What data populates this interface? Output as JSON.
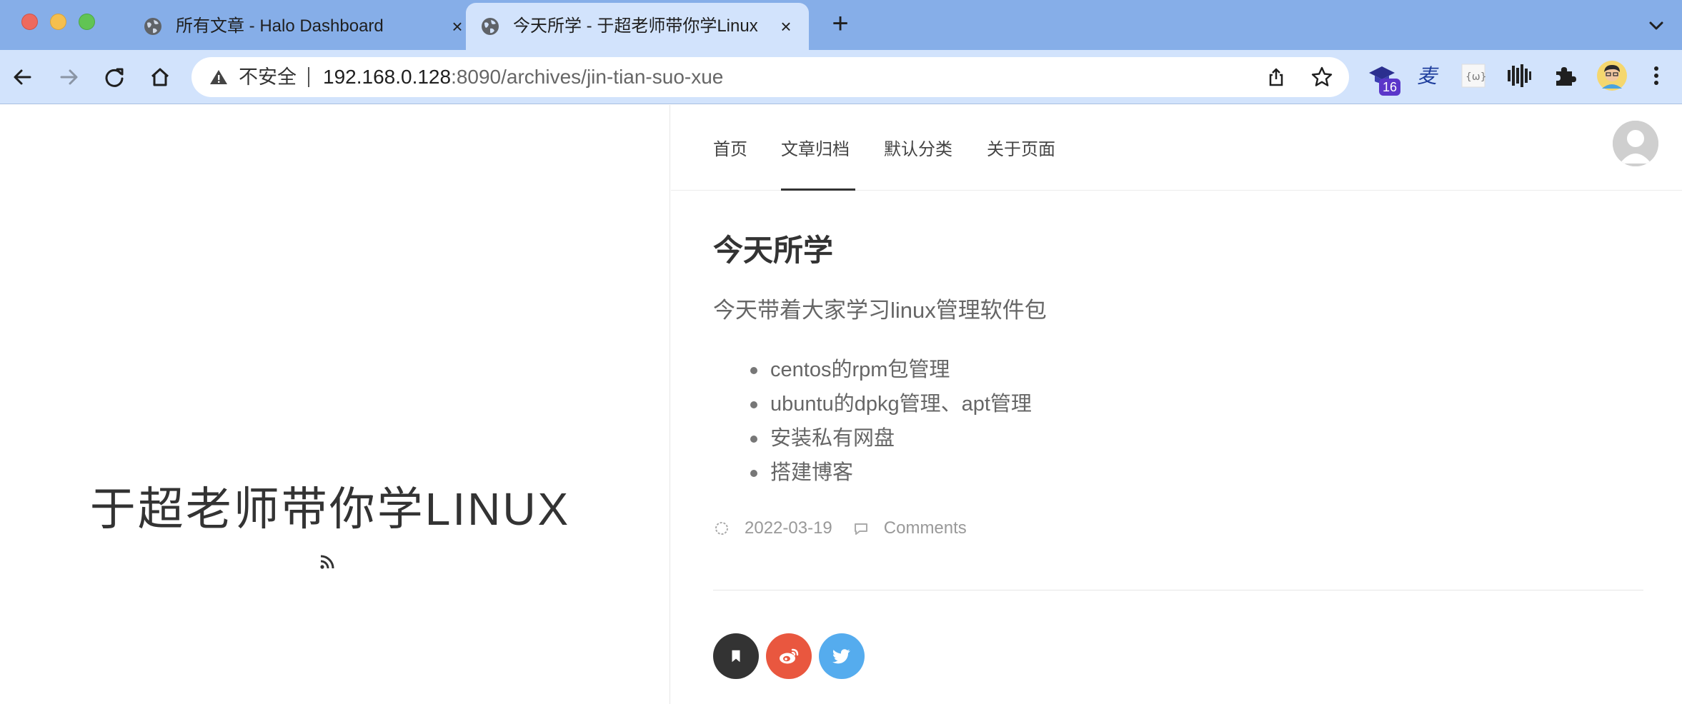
{
  "browser": {
    "tabs": [
      {
        "title": "所有文章 - Halo Dashboard",
        "active": false,
        "icon": "globe-icon"
      },
      {
        "title": "今天所学 - 于超老师带你学Linux",
        "active": true,
        "icon": "globe-icon"
      }
    ],
    "new_tab_label": "+",
    "close_label": "×",
    "address": {
      "security_label": "不安全",
      "url_host": "192.168.0.128",
      "url_rest": ":8090/archives/jin-tian-suo-xue"
    },
    "extensions": {
      "badge_count": "16",
      "icons": [
        "graduation-cap-icon",
        "translate-icon",
        "ocr-icon",
        "audio-bars-icon",
        "puzzle-icon",
        "profile-avatar-icon"
      ]
    },
    "colors": {
      "tabstrip": "#86aee8",
      "toolbar": "#d2e3fc",
      "badge": "#5b36c9"
    }
  },
  "site": {
    "title": "于超老师带你学LINUX",
    "rss_icon": "rss-icon"
  },
  "nav": {
    "items": [
      "首页",
      "文章归档",
      "默认分类",
      "关于页面"
    ],
    "active_index": 1
  },
  "post": {
    "title": "今天所学",
    "intro": "今天带着大家学习linux管理软件包",
    "list": [
      "centos的rpm包管理",
      "ubuntu的dpkg管理、apt管理",
      "安装私有网盘",
      "搭建博客"
    ],
    "date": "2022-03-19",
    "comments_label": "Comments"
  },
  "share": {
    "buttons": [
      {
        "name": "bookmark",
        "color": "#333333"
      },
      {
        "name": "weibo",
        "color": "#e9573f"
      },
      {
        "name": "twitter",
        "color": "#55acee"
      }
    ]
  }
}
